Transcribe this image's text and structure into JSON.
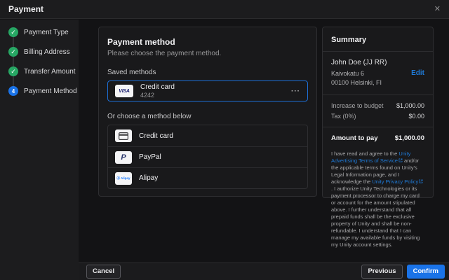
{
  "colors": {
    "accent_blue": "#1a73e8",
    "success_green": "#27a764",
    "link_blue": "#1f7bd8",
    "visa_navy": "#1a1f71",
    "panel_bg": "#19191b",
    "sidebar_bg": "#1c1c1e",
    "page_bg": "#131315"
  },
  "header": {
    "title": "Payment"
  },
  "icons": {
    "close": "✕",
    "check": "✓",
    "more": "···"
  },
  "stepper": {
    "items": [
      {
        "label": "Payment Type",
        "status": "complete"
      },
      {
        "label": "Billing Address",
        "status": "complete"
      },
      {
        "label": "Transfer Amount",
        "status": "complete"
      },
      {
        "label": "Payment Method",
        "status": "current",
        "number": "4"
      }
    ]
  },
  "payment_panel": {
    "title": "Payment method",
    "subtitle": "Please choose the payment method.",
    "saved_methods_label": "Saved methods",
    "saved_card": {
      "brand": "VISA",
      "name": "Credit card",
      "last4": "4242"
    },
    "choose_label": "Or choose a method below",
    "methods": [
      {
        "label": "Credit card"
      },
      {
        "label": "PayPal",
        "logo_letter": "P"
      },
      {
        "label": "Alipay",
        "badge": "Ⓐ Alipay"
      }
    ]
  },
  "summary": {
    "title": "Summary",
    "billing": {
      "name": "John Doe (JJ RR)",
      "address_line1": "Kaivokatu 6",
      "address_line2": "00100 Helsinki, FI",
      "edit_label": "Edit"
    },
    "rows": [
      {
        "label": "Increase to budget",
        "value": "$1,000.00"
      },
      {
        "label": "Tax (0%)",
        "value": "$0.00"
      }
    ],
    "total": {
      "label": "Amount to pay",
      "value": "$1,000.00"
    },
    "legal": {
      "t1": "I have read and agree to the ",
      "link1": "Unity Advertising Terms of Service",
      "t2": " and/or the applicable terms found on Unity's Legal Information page, and I acknowledge the ",
      "link2": "Unity Privacy Policy",
      "t3": ". I authorize Unity Technologies or its payment processor to charge my card or account for the amount stipulated above. I further understand that all prepaid funds shall be the exclusive property of Unity and shall be non-refundable. I understand that I can manage my available funds by visiting my Unity account settings."
    }
  },
  "footer": {
    "cancel_label": "Cancel",
    "previous_label": "Previous",
    "confirm_label": "Confirm"
  }
}
